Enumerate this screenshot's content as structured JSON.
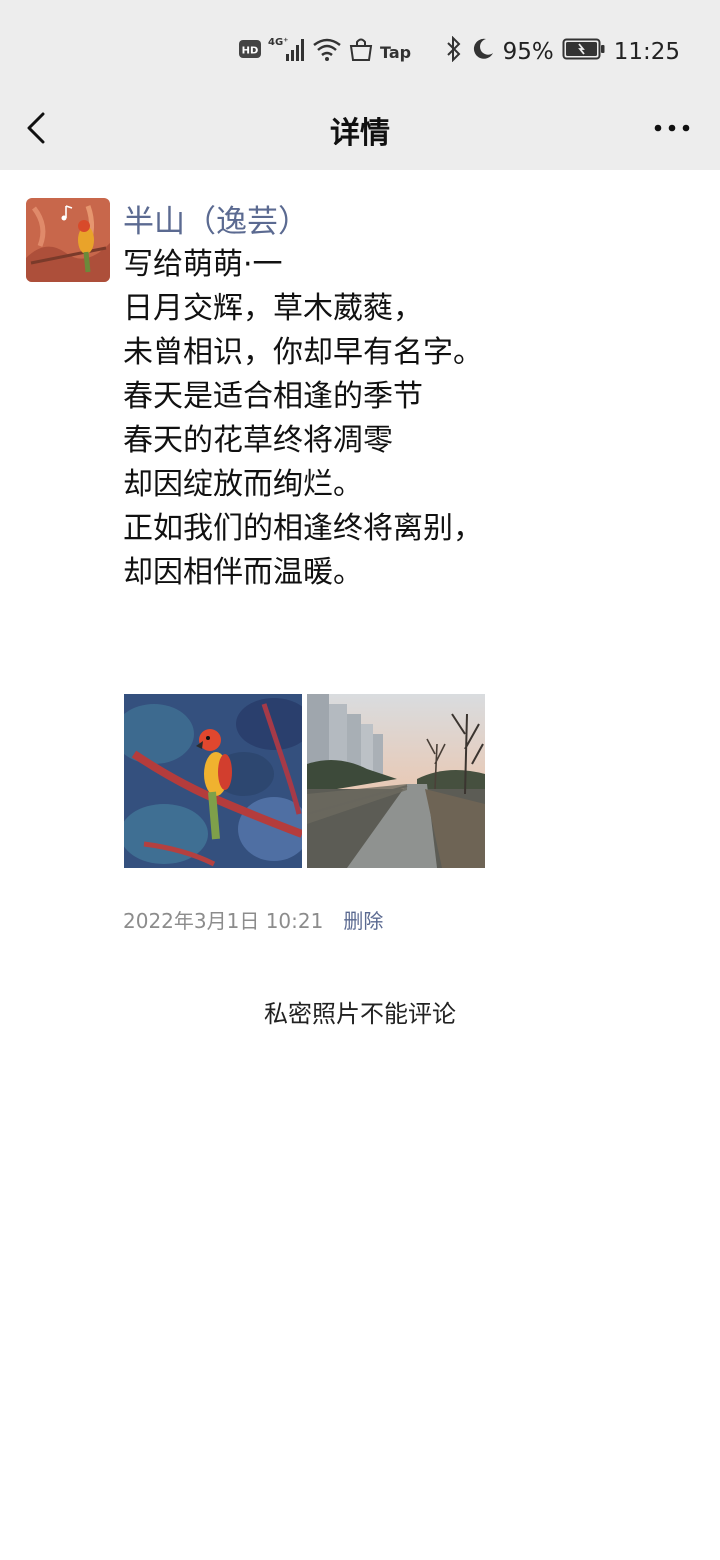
{
  "status_bar": {
    "network_hd": "HD",
    "network_4g": "4G⁺",
    "tap_label": "Tap",
    "battery_percent": "95%",
    "time": "11:25",
    "icons": [
      "hd-icon",
      "signal-icon",
      "wifi-icon",
      "bag-icon",
      "bluetooth-icon",
      "moon-icon",
      "battery-icon"
    ]
  },
  "navbar": {
    "title": "详情",
    "back_icon": "chevron-left-icon",
    "more_icon": "more-dots-icon"
  },
  "post": {
    "author": "半山（逸芸）",
    "lines": [
      "写给萌萌·一",
      "日月交辉，草木葳蕤，",
      "未曾相识，你却早有名字。",
      "春天是适合相逢的季节",
      "春天的花草终将凋零",
      "却因绽放而绚烂。",
      "正如我们的相逢终将离别，",
      "却因相伴而温暖。"
    ],
    "photos": [
      "parrot-illustration",
      "city-walkway-photo"
    ],
    "timestamp": "2022年3月1日 10:21",
    "delete_label": "删除",
    "private_note": "私密照片不能评论"
  },
  "colors": {
    "topbar_bg": "#ededed",
    "link_blue": "#5b6a91",
    "meta_gray": "#8c8c8c"
  }
}
